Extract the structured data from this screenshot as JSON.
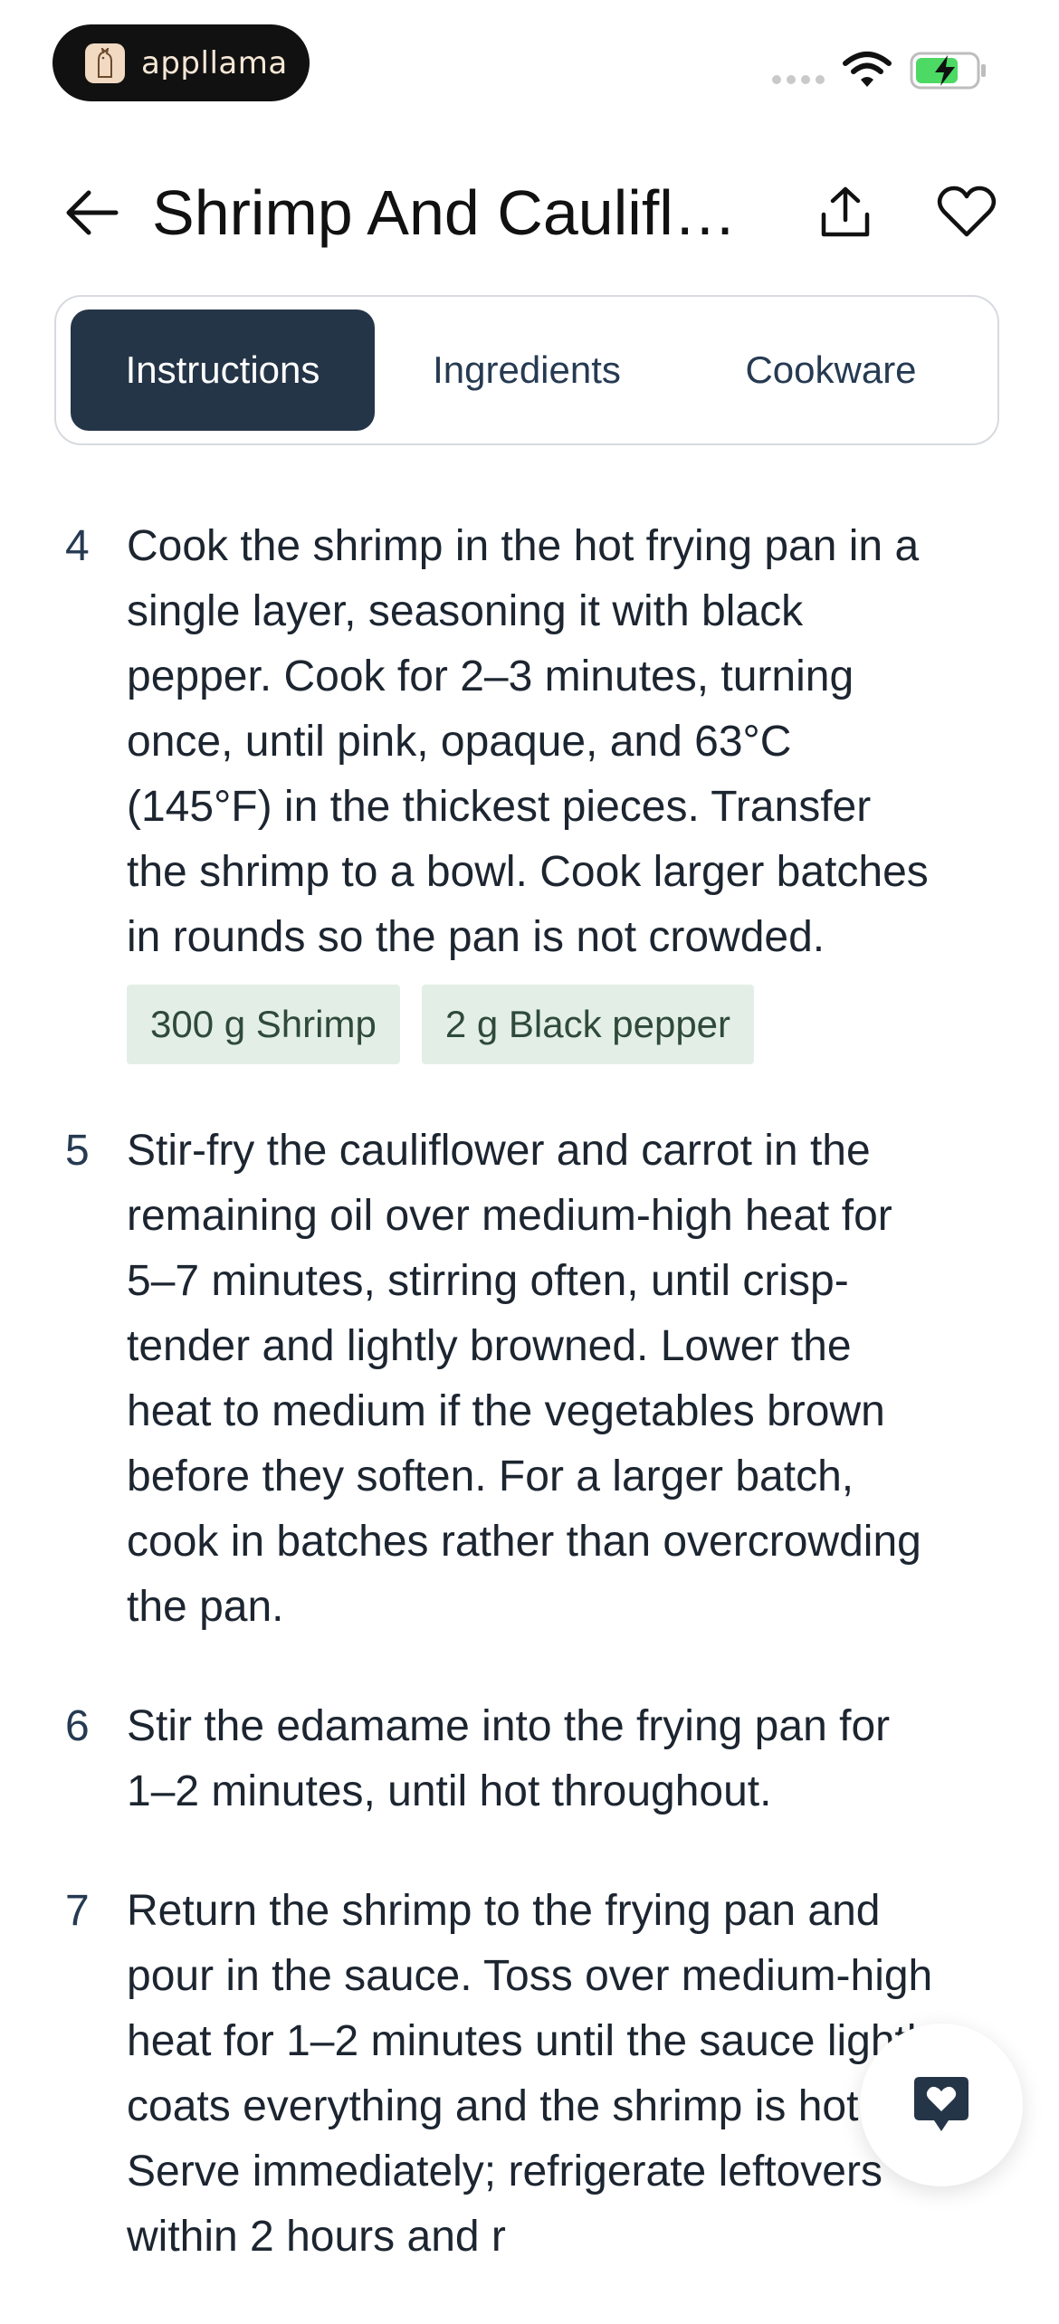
{
  "status_bar": {
    "app_name": "appllama"
  },
  "header": {
    "title": "Shrimp And Cauliflo…"
  },
  "tabs": [
    {
      "label": "Instructions",
      "active": true
    },
    {
      "label": "Ingredients",
      "active": false
    },
    {
      "label": "Cookware",
      "active": false
    }
  ],
  "steps": [
    {
      "number": "4",
      "text": "Cook the shrimp in the hot frying pan in a single layer, seasoning it with black pepper. Cook for 2–3 minutes, turning once, until pink, opaque, and 63°C (145°F) in the thickest pieces. Transfer the shrimp to a bowl. Cook larger batches in rounds so the pan is not crowded.",
      "chips": [
        "300 g Shrimp",
        "2 g Black pepper"
      ]
    },
    {
      "number": "5",
      "text": "Stir-fry the cauliflower and carrot in the remaining oil over medium-high heat for 5–7 minutes, stirring often, until crisp-tender and lightly browned. Lower the heat to medium if the vegetables brown before they soften. For a larger batch, cook in batches rather than overcrowding the pan."
    },
    {
      "number": "6",
      "text": "Stir the edamame into the frying pan for 1–2 minutes, until hot throughout."
    },
    {
      "number": "7",
      "text": "Return the shrimp to the frying pan and pour in the sauce. Toss over medium-high heat for 1–2 minutes until the sauce lightly coats everything and the shrimp is hot. Serve immediately; refrigerate leftovers within 2 hours and r"
    }
  ],
  "colors": {
    "accent_dark": "#253548",
    "chip_bg": "#e3efe6",
    "battery_green": "#4cd964"
  },
  "icons": {
    "back": "arrow-left-icon",
    "share": "share-icon",
    "favorite": "heart-icon",
    "chat": "chat-heart-icon"
  }
}
